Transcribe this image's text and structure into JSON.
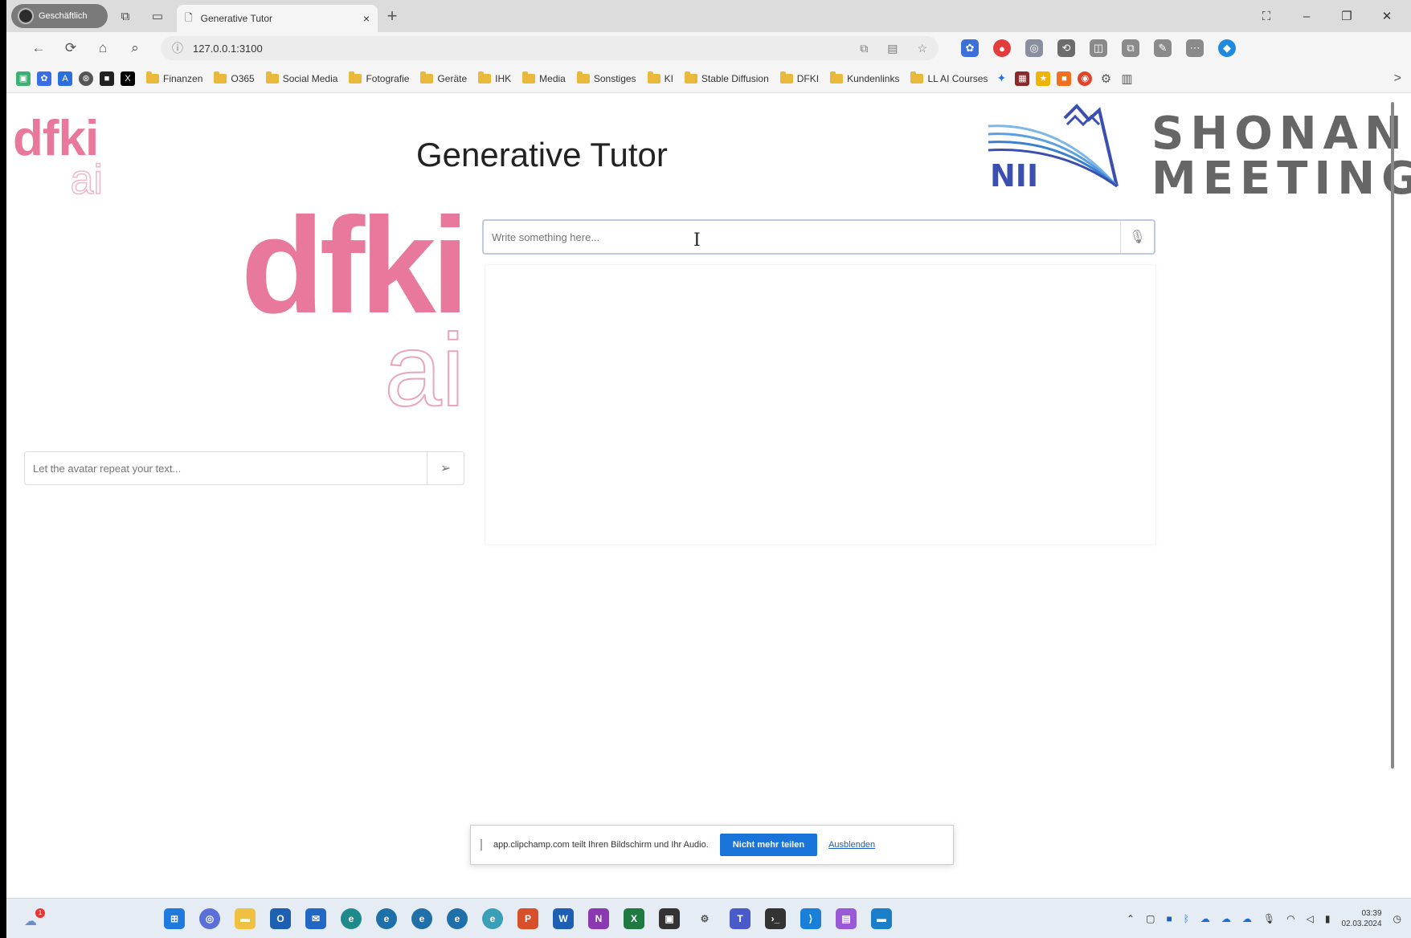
{
  "browser": {
    "profile_label": "Geschäftlich",
    "tab_title": "Generative Tutor",
    "tab_close": "×",
    "new_tab": "+",
    "url": "127.0.0.1:3100",
    "win_controls": [
      "⛶",
      "–",
      "❐",
      "✕"
    ],
    "nav_icons": [
      "⟳",
      "⌂",
      "⌕"
    ]
  },
  "bookmarks": {
    "folders": [
      "Finanzen",
      "O365",
      "Social Media",
      "Fotografie",
      "Geräte",
      "IHK",
      "Media",
      "Sonstiges",
      "KI",
      "Stable Diffusion",
      "DFKI",
      "Kundenlinks",
      "LL AI Courses"
    ],
    "more": ">"
  },
  "page": {
    "title": "Generative Tutor",
    "small_logo_top": "dfki",
    "small_logo_bottom": "ai",
    "big_logo_top": "dfki",
    "big_logo_bottom": "ai",
    "avatar_input_placeholder": "Let the avatar repeat your text...",
    "chat_input_placeholder": "Write something here...",
    "nii_label": "NII",
    "shonan_line1": "SHONAN",
    "shonan_line2": "MEETING"
  },
  "share_bar": {
    "message": "app.clipchamp.com teilt Ihren Bildschirm und Ihr Audio.",
    "stop_label": "Nicht mehr teilen",
    "hide_label": "Ausblenden"
  },
  "taskbar": {
    "notification_count": "1",
    "time": "03:39",
    "date": "02.03.2024"
  },
  "colors": {
    "dfki_pink": "#e8789c",
    "nii_blue": "#3a4fb0",
    "share_button": "#1a73d9"
  }
}
